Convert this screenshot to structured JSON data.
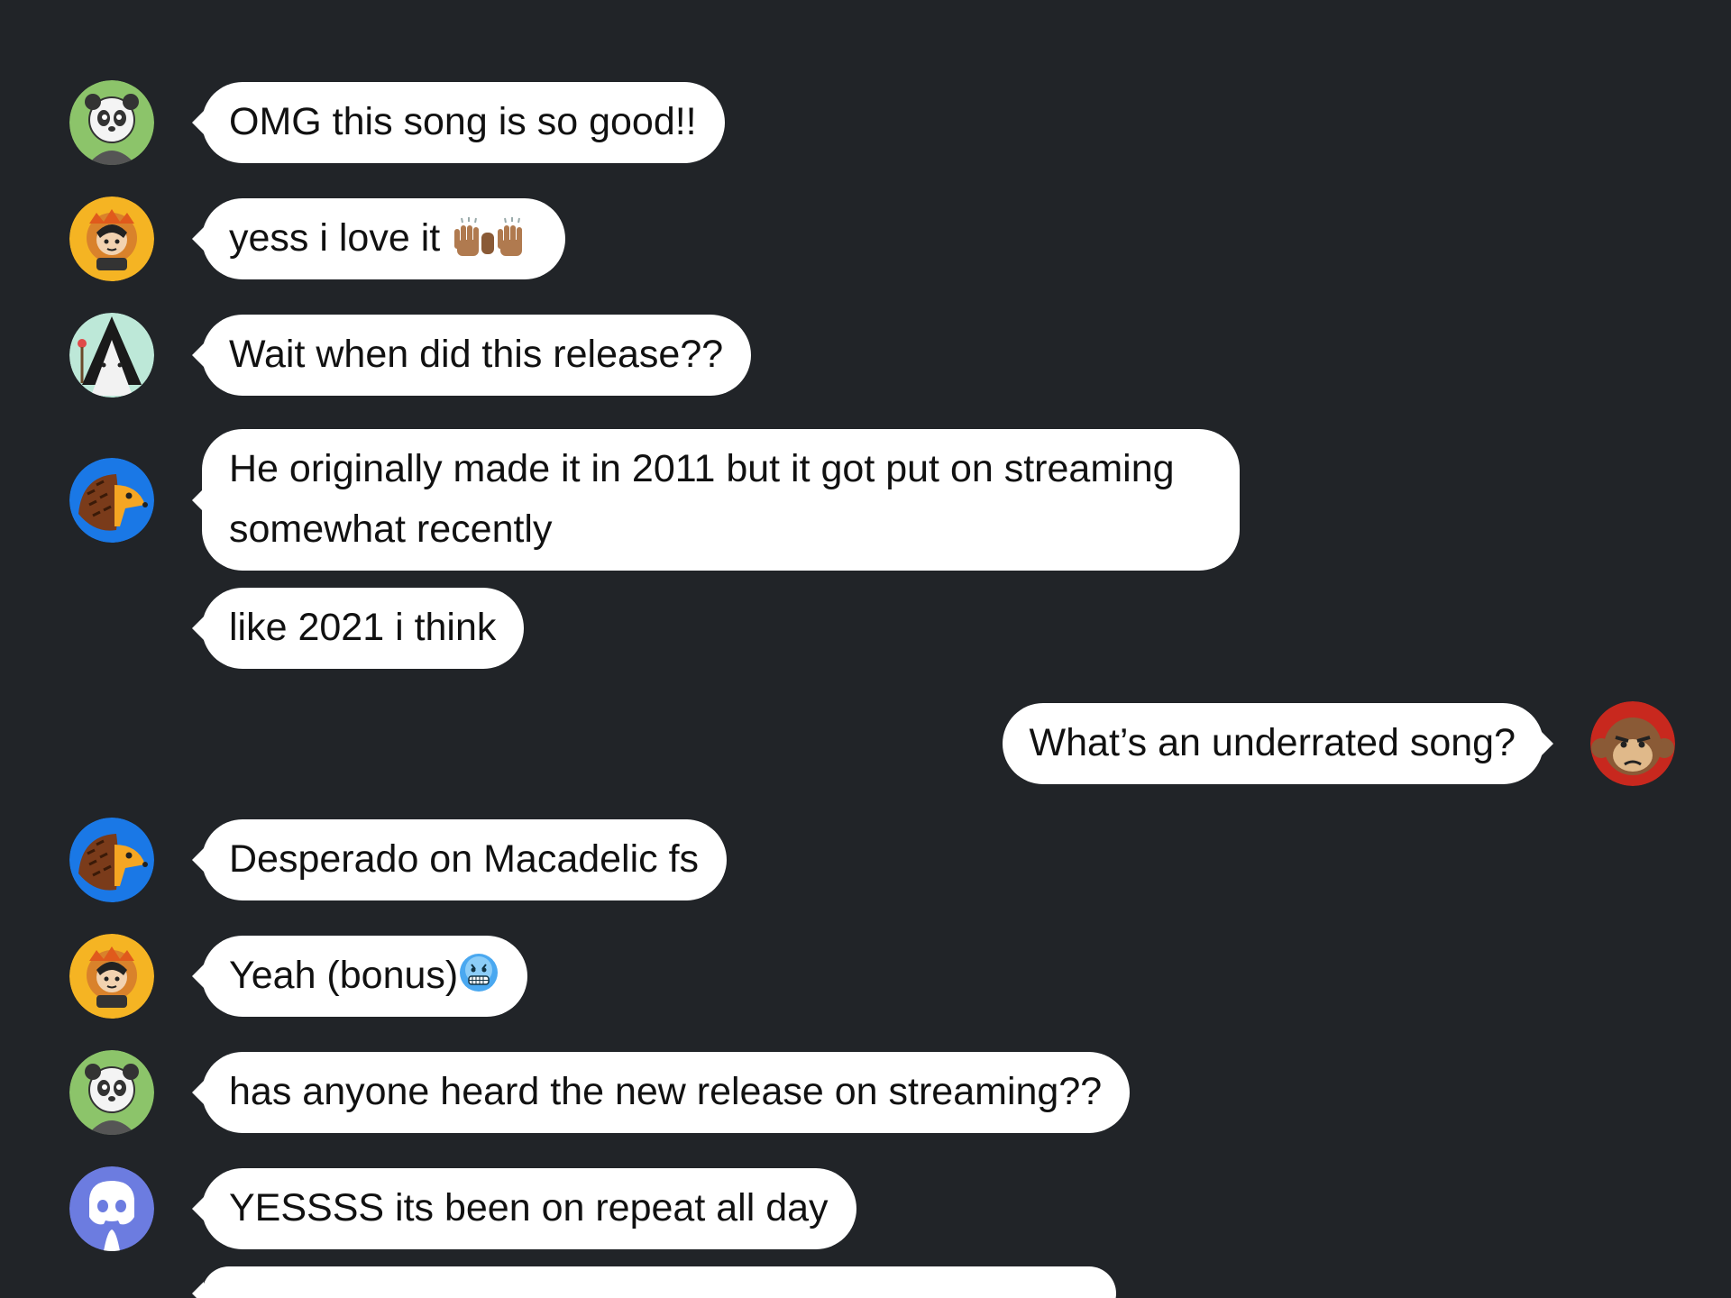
{
  "messages": [
    {
      "text": "OMG this song is so good!!",
      "avatar": "panda-avatar-icon",
      "side": "left"
    },
    {
      "text": "yess i love it",
      "emoji": "raising-hands-emoji",
      "avatar": "lion-avatar-icon",
      "side": "left"
    },
    {
      "text": "Wait when did this release??",
      "avatar": "wizard-avatar-icon",
      "side": "left"
    },
    {
      "text": "He originally made it in 2011 but it got put on streaming somewhat recently",
      "avatar": "hedgehog-avatar-icon",
      "side": "left"
    },
    {
      "text": "like 2021 i think",
      "side": "left"
    },
    {
      "text": "What’s an underrated song?",
      "avatar": "monkey-avatar-icon",
      "side": "right"
    },
    {
      "text": "Desperado on Macadelic fs",
      "avatar": "hedgehog-avatar-icon",
      "side": "left"
    },
    {
      "text": "Yeah (bonus)",
      "emoji": "cold-face-emoji",
      "avatar": "lion-avatar-icon",
      "side": "left"
    },
    {
      "text": "has anyone heard the new release on streaming??",
      "avatar": "panda-avatar-icon",
      "side": "left"
    },
    {
      "text": "YESSSS its been on repeat all day",
      "avatar": "discord-avatar-icon",
      "side": "left"
    }
  ],
  "colors": {
    "background": "#212428",
    "bubble": "#ffffff",
    "text": "#111111",
    "discord_blurple": "#6c7ce0",
    "avatar_blue": "#1a78e6",
    "avatar_gold": "#f5b423",
    "avatar_green": "#8cc46a",
    "avatar_mint": "#bde8d8"
  }
}
